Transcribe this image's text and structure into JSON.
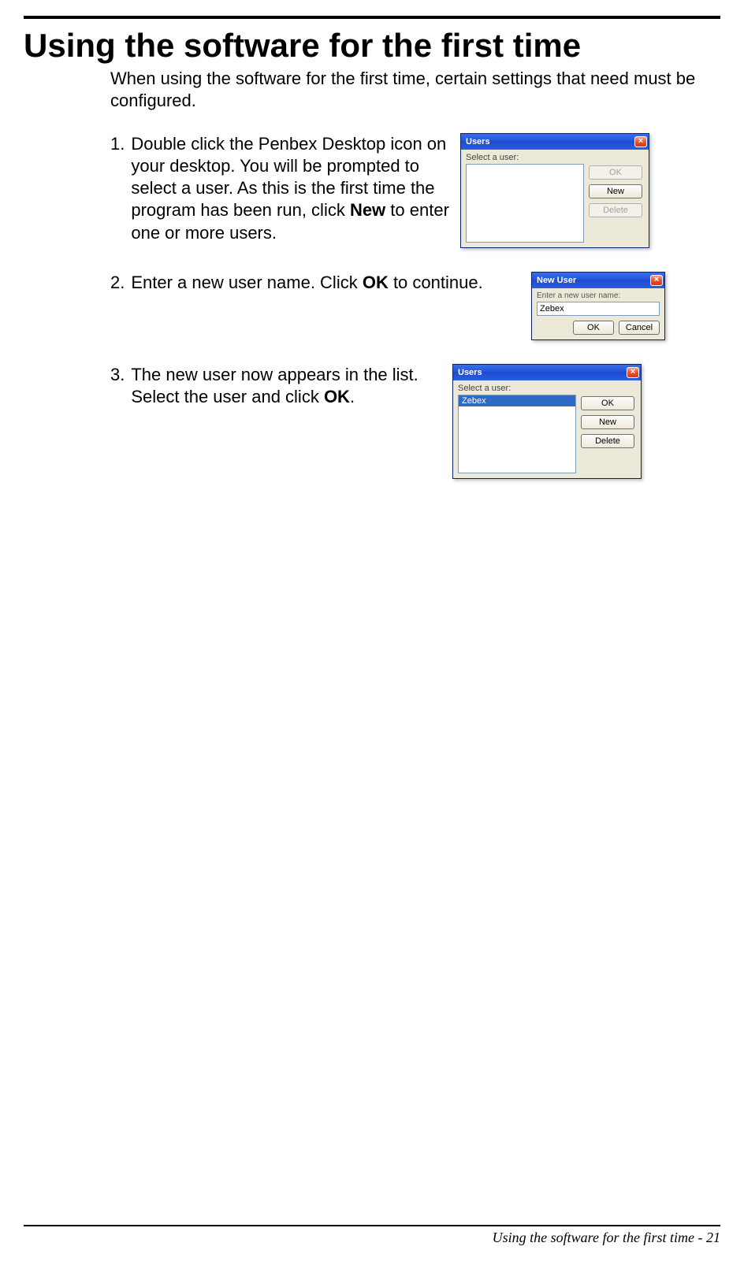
{
  "heading": "Using the software for the first time",
  "intro": "When using the software for the first time, certain settings that need must be configured.",
  "steps": {
    "s1": {
      "num": "1.",
      "t1": "Double click the Penbex Desktop icon on your desktop. You will be prompted to select a user. As this is the first time the program has been run, click ",
      "bold": "New",
      "t2": " to enter one or more users."
    },
    "s2": {
      "num": "2.",
      "t1": "Enter a new user name. Click ",
      "bold": "OK",
      "t2": " to continue."
    },
    "s3": {
      "num": "3.",
      "t1": "The new user now appears in the list. Select the user and click ",
      "bold": "OK",
      "t2": "."
    }
  },
  "dlg1": {
    "title": "Users",
    "close_x": "×",
    "label": "Select a user:",
    "ok": "OK",
    "new": "New",
    "delete": "Delete"
  },
  "dlg2": {
    "title": "New User",
    "close_x": "×",
    "label": "Enter a new user name:",
    "value": "Zebex",
    "ok": "OK",
    "cancel": "Cancel"
  },
  "dlg3": {
    "title": "Users",
    "close_x": "×",
    "label": "Select a user:",
    "item": "Zebex",
    "ok": "OK",
    "new": "New",
    "delete": "Delete"
  },
  "footer": "Using the software for the first time - 21"
}
